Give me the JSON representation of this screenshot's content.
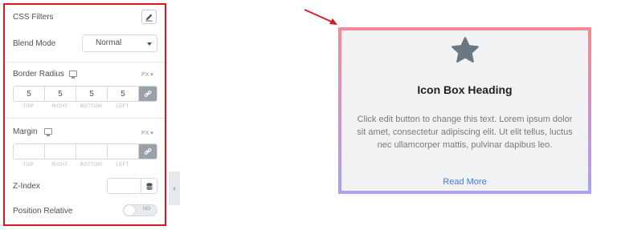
{
  "panel": {
    "css_filters": "CSS Filters",
    "blend_mode_label": "Blend Mode",
    "blend_mode_value": "Normal",
    "border_radius_label": "Border Radius",
    "unit": "PX",
    "border_radius_values": [
      "5",
      "5",
      "5",
      "5"
    ],
    "dim_labels": [
      "TOP",
      "RIGHT",
      "BOTTOM",
      "LEFT"
    ],
    "margin_label": "Margin",
    "margin_values": [
      "",
      "",
      "",
      ""
    ],
    "zindex_label": "Z-Index",
    "position_relative_label": "Position Relative",
    "toggle_text": "NO",
    "collapse_arrow": "‹"
  },
  "preview": {
    "heading": "Icon Box Heading",
    "description": "Click edit button to change this text. Lorem ipsum dolor sit amet, consectetur adipiscing elit. Ut elit tellus, luctus nec ullamcorper mattis, pulvinar dapibus leo.",
    "read_more": "Read More",
    "icon": "star-icon",
    "gradient_top": "#f48a94",
    "gradient_bottom": "#a9a2f2",
    "accent": "#e0141e"
  }
}
